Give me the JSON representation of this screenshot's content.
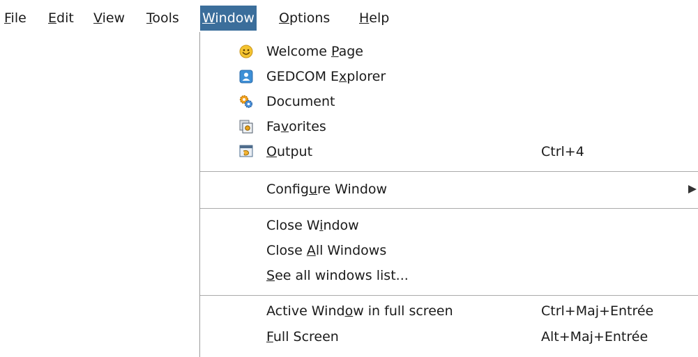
{
  "menubar": {
    "items": [
      {
        "pre": "",
        "mn": "F",
        "post": "ile",
        "active": false
      },
      {
        "pre": "",
        "mn": "E",
        "post": "dit",
        "active": false
      },
      {
        "pre": "",
        "mn": "V",
        "post": "iew",
        "active": false
      },
      {
        "pre": "",
        "mn": "T",
        "post": "ools",
        "active": false
      },
      {
        "pre": "",
        "mn": "W",
        "post": "indow",
        "active": true
      },
      {
        "pre": "",
        "mn": "O",
        "post": "ptions",
        "active": false
      },
      {
        "pre": "",
        "mn": "H",
        "post": "elp",
        "active": false
      }
    ]
  },
  "window_menu": {
    "welcome": {
      "pre": "Welcome ",
      "mn": "P",
      "post": "age",
      "icon": "smiley-icon"
    },
    "gedcom": {
      "pre": "GEDCOM E",
      "mn": "x",
      "post": "plorer",
      "icon": "person-card-icon"
    },
    "document": {
      "pre": "Document",
      "mn": "",
      "post": "",
      "icon": "gears-icon"
    },
    "favorites": {
      "pre": "Fa",
      "mn": "v",
      "post": "orites",
      "icon": "favorites-icon"
    },
    "output": {
      "pre": "",
      "mn": "O",
      "post": "utput",
      "shortcut": "Ctrl+4",
      "icon": "output-console-icon"
    },
    "configure": {
      "pre": "Config",
      "mn": "u",
      "post": "re Window",
      "icon": "submenu-arrow-icon"
    },
    "close_window": {
      "pre": "Close W",
      "mn": "i",
      "post": "ndow"
    },
    "close_all": {
      "pre": "Close ",
      "mn": "A",
      "post": "ll Windows"
    },
    "see_all": {
      "pre": "",
      "mn": "S",
      "post": "ee all windows list..."
    },
    "active_full": {
      "pre": "Active Wind",
      "mn": "o",
      "post": "w in full screen",
      "shortcut": "Ctrl+Maj+Entrée"
    },
    "full_screen": {
      "pre": "",
      "mn": "F",
      "post": "ull Screen",
      "shortcut": "Alt+Maj+Entrée"
    }
  },
  "colors": {
    "menu_highlight": "#3b6e9b",
    "menu_text": "#1a1a1a",
    "separator": "#aaaaaa"
  }
}
